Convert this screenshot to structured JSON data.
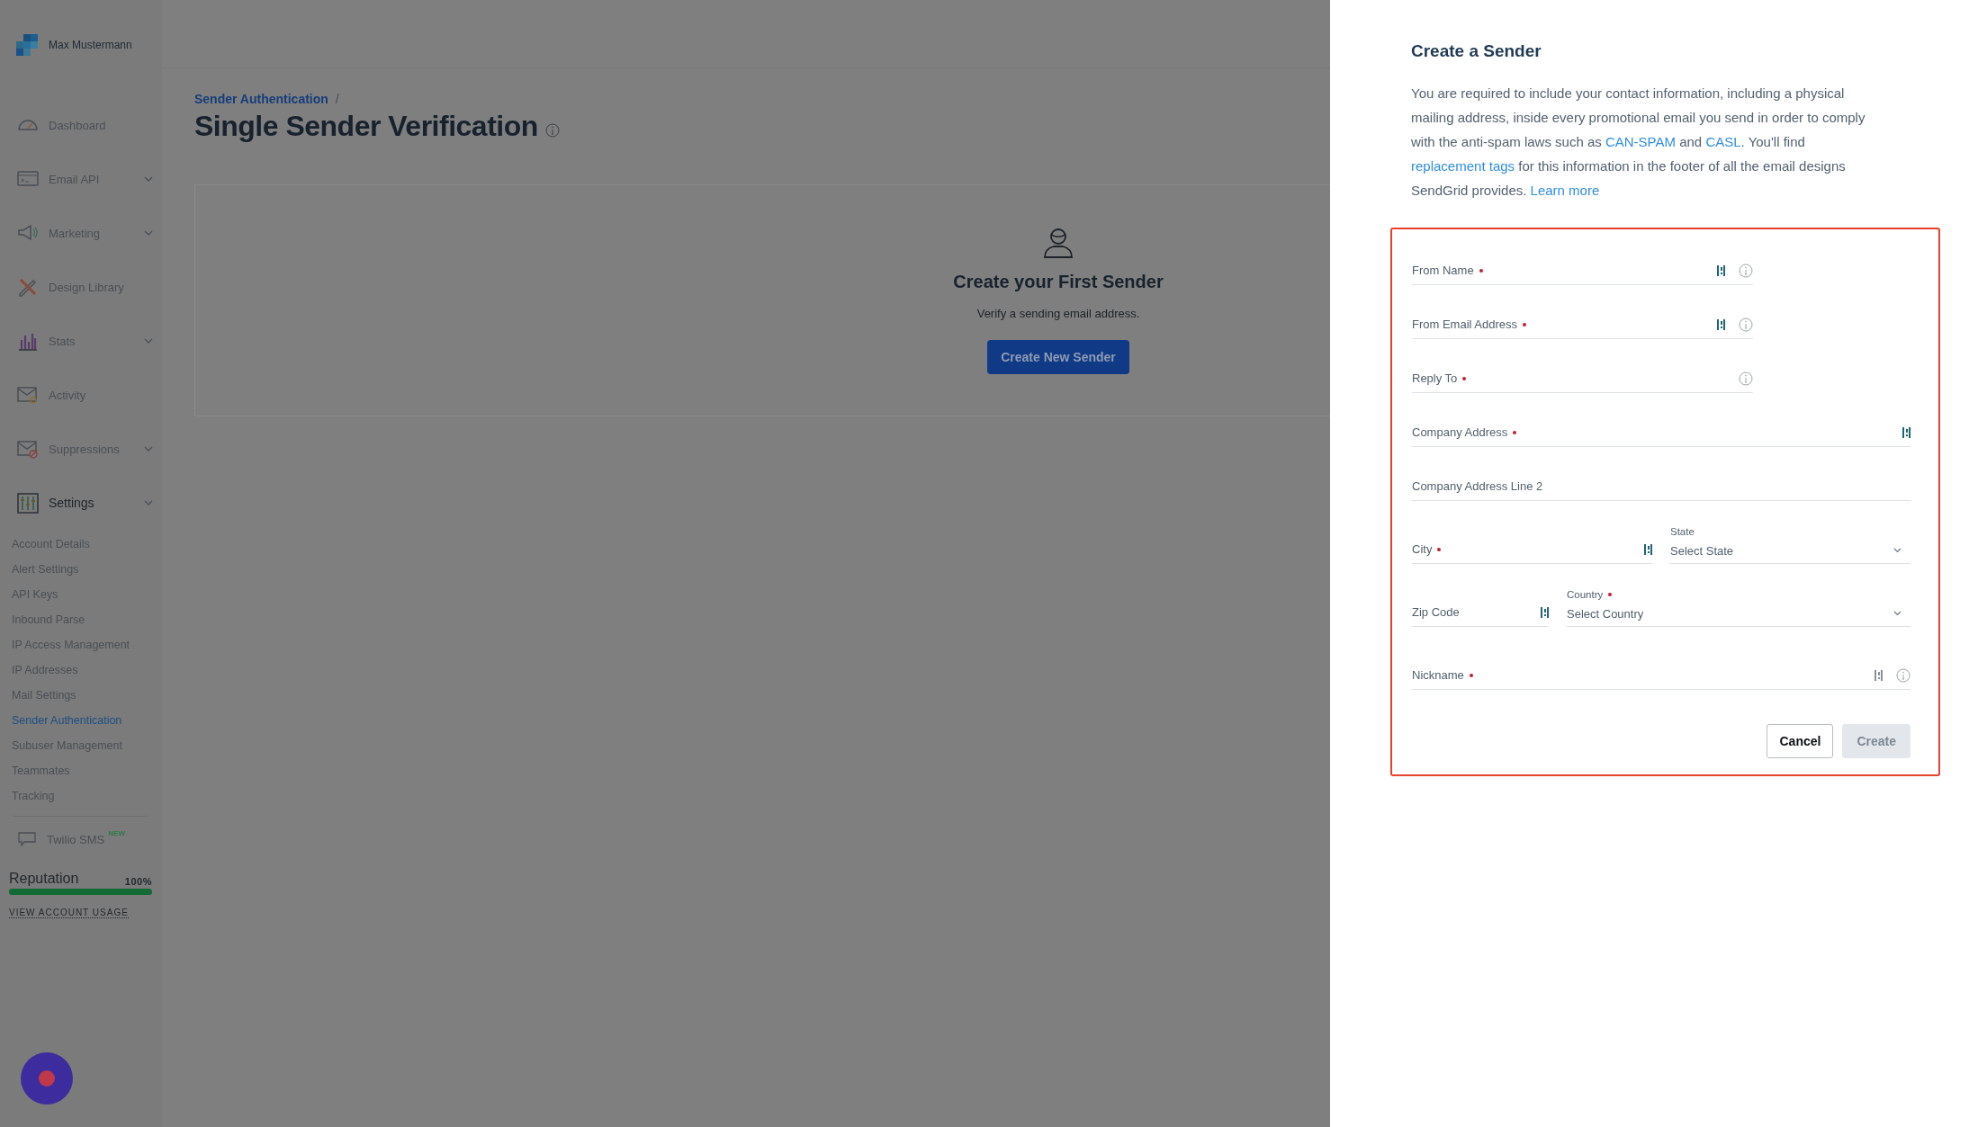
{
  "sidebar": {
    "user_name": "Max Mustermann",
    "nav": [
      {
        "label": "Dashboard",
        "expandable": false,
        "selected": false
      },
      {
        "label": "Email API",
        "expandable": true,
        "selected": false
      },
      {
        "label": "Marketing",
        "expandable": true,
        "selected": false
      },
      {
        "label": "Design Library",
        "expandable": false,
        "selected": false
      },
      {
        "label": "Stats",
        "expandable": true,
        "selected": false
      },
      {
        "label": "Activity",
        "expandable": false,
        "selected": false
      },
      {
        "label": "Suppressions",
        "expandable": true,
        "selected": false
      },
      {
        "label": "Settings",
        "expandable": true,
        "selected": true
      }
    ],
    "subnav": [
      {
        "label": "Account Details",
        "selected": false
      },
      {
        "label": "Alert Settings",
        "selected": false
      },
      {
        "label": "API Keys",
        "selected": false
      },
      {
        "label": "Inbound Parse",
        "selected": false
      },
      {
        "label": "IP Access Management",
        "selected": false
      },
      {
        "label": "IP Addresses",
        "selected": false
      },
      {
        "label": "Mail Settings",
        "selected": false
      },
      {
        "label": "Sender Authentication",
        "selected": true
      },
      {
        "label": "Subuser Management",
        "selected": false
      },
      {
        "label": "Teammates",
        "selected": false
      },
      {
        "label": "Tracking",
        "selected": false
      }
    ],
    "sms": {
      "label": "Twilio SMS",
      "badge": "NEW"
    },
    "reputation": {
      "label": "Reputation",
      "value": "100%",
      "level": 1
    },
    "usage_link": "VIEW ACCOUNT USAGE"
  },
  "main": {
    "breadcrumb": "Sender Authentication",
    "separator": "/",
    "title": "Single Sender Verification",
    "empty_state": {
      "title": "Create your First Sender",
      "text": "Verify a sending email address.",
      "button": "Create New Sender"
    }
  },
  "drawer": {
    "title": "Create a Sender",
    "description": [
      {
        "text": "You are required to include your contact information, including a physical mailing address, inside every promotional email you send in order to comply with the anti-spam laws such as ",
        "link": false
      },
      {
        "text": "CAN-SPAM",
        "link": true
      },
      {
        "text": " and ",
        "link": false
      },
      {
        "text": "CASL",
        "link": true
      },
      {
        "text": ". You'll find ",
        "link": false
      },
      {
        "text": "replacement tags",
        "link": true
      },
      {
        "text": " for this information in the footer of all the email designs SendGrid provides. ",
        "link": false
      },
      {
        "text": "Learn more",
        "link": true
      }
    ],
    "rows": [
      [
        {
          "kind": "text",
          "label": "From Name",
          "required": true,
          "autofill": true,
          "autofill_disabled": false,
          "info": true
        }
      ],
      [
        {
          "kind": "text",
          "label": "From Email Address",
          "required": true,
          "autofill": true,
          "autofill_disabled": false,
          "info": true
        }
      ],
      [
        {
          "kind": "text",
          "label": "Reply To",
          "required": true,
          "autofill": false,
          "info": true
        }
      ],
      [
        {
          "kind": "text",
          "label": "Company Address",
          "required": true,
          "autofill": true,
          "autofill_disabled": false,
          "info": false
        }
      ],
      [
        {
          "kind": "text",
          "label": "Company Address Line 2",
          "required": false,
          "autofill": false,
          "info": false
        }
      ],
      [
        {
          "kind": "text",
          "label": "City",
          "required": true,
          "autofill": true,
          "autofill_disabled": false,
          "info": false
        },
        {
          "kind": "select",
          "label": "State",
          "required": false,
          "placeholder": "Select State"
        }
      ],
      [
        {
          "kind": "text",
          "label": "Zip Code",
          "required": false,
          "autofill": true,
          "autofill_disabled": false,
          "info": false
        },
        {
          "kind": "select",
          "label": "Country",
          "required": true,
          "placeholder": "Select Country"
        }
      ],
      [
        {
          "kind": "text",
          "label": "Nickname",
          "required": true,
          "autofill": true,
          "autofill_disabled": true,
          "info": true
        }
      ]
    ],
    "buttons": [
      {
        "label": "Cancel",
        "disabled": false
      },
      {
        "label": "Create",
        "disabled": true
      }
    ]
  }
}
